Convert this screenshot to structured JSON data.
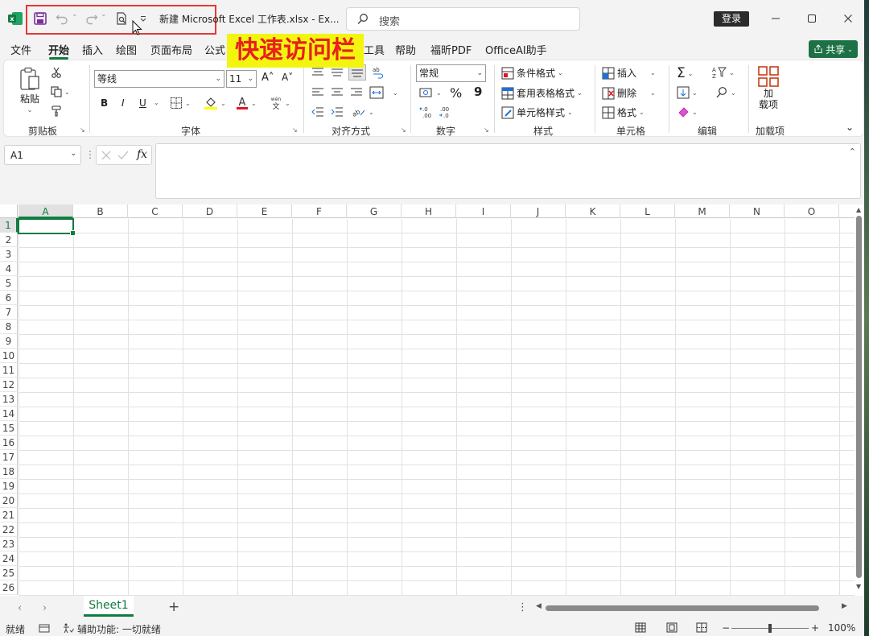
{
  "title_bar": {
    "document_title": "新建 Microsoft Excel 工作表.xlsx  -  Ex...",
    "search_placeholder": "搜索",
    "login_label": "登录",
    "icons": [
      "excel-logo",
      "save-icon",
      "undo-icon",
      "redo-icon",
      "print-preview-icon",
      "customize-qat-icon"
    ]
  },
  "annotation": {
    "text": "快速访问栏",
    "background": "#f3f50f",
    "color": "#e8201c"
  },
  "menu_tabs": [
    {
      "label": "文件"
    },
    {
      "label": "开始"
    },
    {
      "label": "插入"
    },
    {
      "label": "绘图"
    },
    {
      "label": "页面布局"
    },
    {
      "label": "公式"
    },
    {
      "label": "工具"
    },
    {
      "label": "帮助"
    },
    {
      "label": "福昕PDF"
    },
    {
      "label": "OfficeAI助手"
    }
  ],
  "active_tab": "开始",
  "share_label": "共享",
  "ribbon": {
    "clipboard": {
      "paste_label": "粘贴",
      "group_label": "剪贴板"
    },
    "font": {
      "font_name": "等线",
      "font_size": "11",
      "bold": "B",
      "italic": "I",
      "underline": "U",
      "grow": "A˄",
      "shrink": "A˅",
      "group_label": "字体"
    },
    "alignment": {
      "group_label": "对齐方式"
    },
    "number": {
      "format": "常规",
      "percent": "%",
      "comma": "9",
      "group_label": "数字"
    },
    "styles": {
      "conditional": "条件格式",
      "table": "套用表格格式",
      "cell_styles": "单元格样式",
      "group_label": "样式"
    },
    "cells": {
      "insert": "插入",
      "delete": "删除",
      "format": "格式",
      "group_label": "单元格"
    },
    "editing": {
      "group_label": "编辑"
    },
    "addins": {
      "label_line1": "加",
      "label_line2": "载项",
      "group_label": "加载项"
    }
  },
  "formula_bar": {
    "name_box": "A1",
    "fx": "fx",
    "formula": ""
  },
  "columns": [
    "A",
    "B",
    "C",
    "D",
    "E",
    "F",
    "G",
    "H",
    "I",
    "J",
    "K",
    "L",
    "M",
    "N",
    "O"
  ],
  "rows": [
    "1",
    "2",
    "3",
    "4",
    "5",
    "6",
    "7",
    "8",
    "9",
    "10",
    "11",
    "12",
    "13",
    "14",
    "15",
    "16",
    "17",
    "18",
    "19",
    "20",
    "21",
    "22",
    "23",
    "24",
    "25",
    "26"
  ],
  "selected_cell": "A1",
  "sheets": [
    {
      "name": "Sheet1",
      "active": true
    }
  ],
  "status_bar": {
    "ready": "就绪",
    "accessibility": "辅助功能: 一切就绪",
    "zoom": "100%"
  },
  "colors": {
    "accent": "#107c41",
    "qat_highlight": "#e53935"
  }
}
